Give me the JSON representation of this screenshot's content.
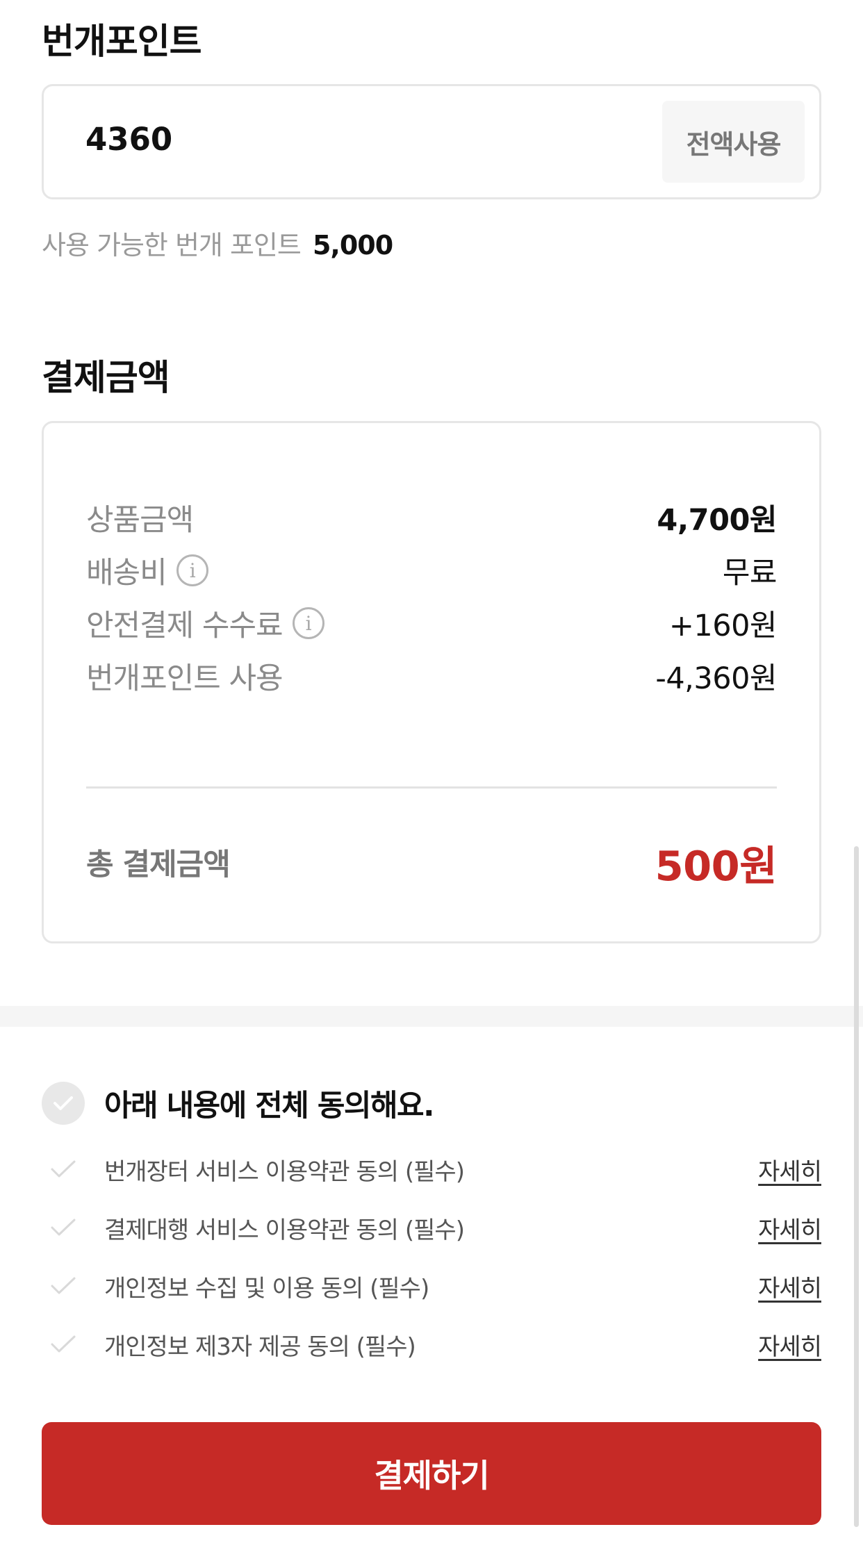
{
  "points": {
    "title": "번개포인트",
    "input_value": "4360",
    "use_all_label": "전액사용",
    "available_label": "사용 가능한 번개 포인트",
    "available_amount": "5,000"
  },
  "payment": {
    "title": "결제금액",
    "rows": [
      {
        "label": "상품금액",
        "value": "4,700원"
      },
      {
        "label": "배송비",
        "value": "무료",
        "info_icon": "info-icon"
      },
      {
        "label": "안전결제 수수료",
        "value": "+160원",
        "info_icon": "info-icon"
      },
      {
        "label": "번개포인트 사용",
        "value": "-4,360원"
      }
    ],
    "total_label": "총 결제금액",
    "total_value": "500원"
  },
  "agreements": {
    "all_label": "아래 내용에 전체 동의해요.",
    "items": [
      {
        "label": "번개장터 서비스 이용약관 동의 (필수)",
        "link": "자세히"
      },
      {
        "label": "결제대행 서비스 이용약관 동의 (필수)",
        "link": "자세히"
      },
      {
        "label": "개인정보 수집 및 이용 동의 (필수)",
        "link": "자세히"
      },
      {
        "label": "개인정보 제3자 제공 동의 (필수)",
        "link": "자세히"
      }
    ]
  },
  "pay_button_label": "결제하기",
  "colors": {
    "accent": "#c62a26",
    "muted_text": "#8a8a8a",
    "border": "#e6e6e6"
  }
}
